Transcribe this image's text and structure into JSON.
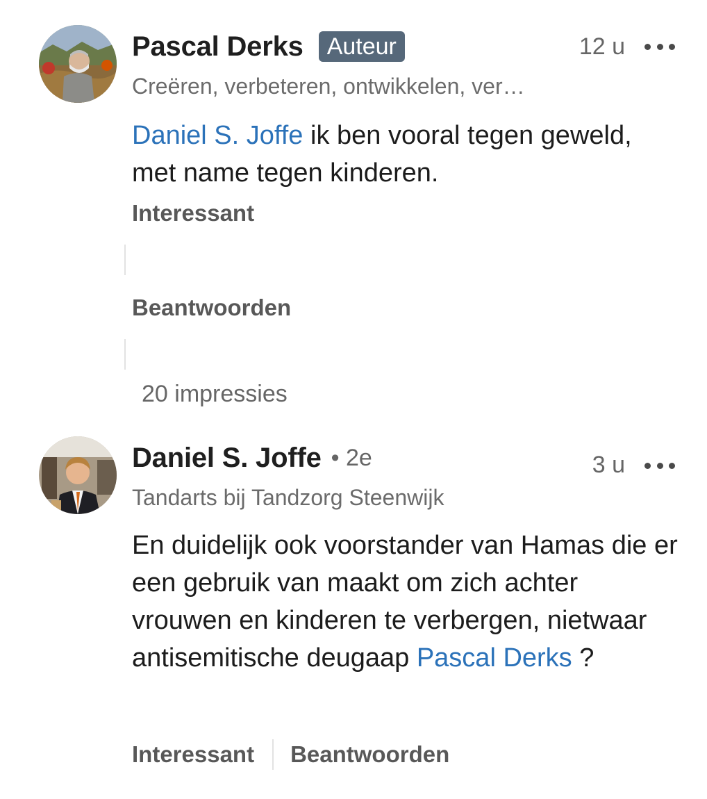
{
  "comments": [
    {
      "author": "Pascal Derks",
      "badge": "Auteur",
      "time": "12 u",
      "headline": "Creëren, verbeteren, ontwikkelen, ver…",
      "mention": "Daniel S. Joffe",
      "text": " ik ben vooral tegen geweld, met name tegen kinderen.",
      "like_label": "Interessant",
      "reply_label": "Beantwoorden",
      "impressions": "20 impressies"
    },
    {
      "author": "Daniel S. Joffe",
      "degree": "• 2e",
      "time": "3 u",
      "headline": "Tandarts bij Tandzorg Steenwijk",
      "text": "En duidelijk ook voorstander van Hamas die er een gebruik van maakt om zich achter vrouwen en kinderen te verbergen, nietwaar antisemitische deugaap ",
      "mention": "Pascal Derks",
      "text_end": " ?",
      "like_label": "Interessant",
      "reply_label": "Beantwoorden"
    }
  ],
  "colors": {
    "mention": "#2b72b9",
    "badge_bg": "#56687a",
    "secondary_text": "#666666"
  },
  "icons": {
    "more": "more-options-icon"
  }
}
